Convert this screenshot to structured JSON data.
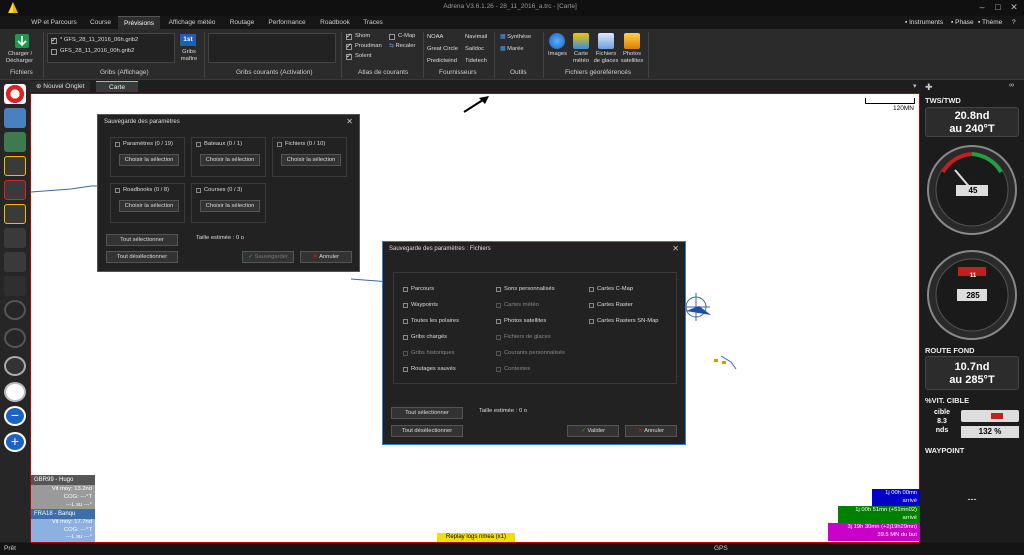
{
  "window": {
    "title": "Adrena V3.6.1.26 - 28_11_2016_a.trc - [Carte]"
  },
  "tabs": [
    "WP et Parcours",
    "Course",
    "Prévisions",
    "Affichage météo",
    "Routage",
    "Performance",
    "Roadbook",
    "Traces"
  ],
  "right_menu": {
    "instruments": "Instruments",
    "phase": "Phase",
    "theme": "Thème"
  },
  "ribbon": {
    "charger": "Charger /",
    "decharger": "Décharger",
    "fichiers": "Fichiers",
    "grib1": "* GFS_28_11_2016_06h.grib2",
    "grib2": "GFS_28_11_2016_00h.grib2",
    "gribs_affichage": "Gribs (Affichage)",
    "first_badge": "1st",
    "gribs_maitre": "Gribs maître",
    "gribs_courants": "Gribs courants (Activation)",
    "shom": "Shom",
    "proudman": "Proudman",
    "solent": "Solent",
    "cmap": "C-Map",
    "recaler": "Recaler",
    "atlas": "Atlas de courants",
    "noaa": "NOAA",
    "navimail": "Navimail",
    "greatcircle": "Great Circle",
    "saildoc": "Saildoc",
    "predictwind": "Predictwind",
    "tidetech": "Tidetech",
    "fournisseurs": "Fournisseurs",
    "synthese": "Synthèse",
    "maree": "Marée",
    "outils": "Outils",
    "images": "Images",
    "carte_meteo": "Carte météo",
    "fichiers_glaces": "Fichiers de glaces",
    "photos_sat": "Photos satellites",
    "fichiers_geo": "Fichiers géoréférencés"
  },
  "doc_tabs": {
    "nouvel_onglet": "Nouvel Onglet",
    "carte": "Carte"
  },
  "map": {
    "scale": "120MN",
    "boat_info_gb": "GBR99 - Hugo",
    "vit_moy_gb": "Vit moy: 13.2nd",
    "cog_gb": "COG: ---°T",
    "lsu_gb": "---L su ---°",
    "boat_info_fr": "FRA18 - Banqu",
    "vit_moy_fr": "Vit moy: 17.7nd",
    "cog_fr": "COG: ---°T",
    "lsu_fr": "---L su ---°",
    "replay": "Replay logs nmea (x1)"
  },
  "routes": [
    {
      "line1": "1j 00h 00mn",
      "line2": "arrivé",
      "color": "#0000c8"
    },
    {
      "line1": "1j 00h 51mn (+51mn02)",
      "line2": "arrivé",
      "color": "#008000"
    },
    {
      "line1": "3j 19h 30mn (+2j19h29mn)",
      "line2": "39.5 MN du but",
      "color": "#c800c8"
    }
  ],
  "panel": {
    "tws_twd": "TWS/TWD",
    "tws": "20.8nd",
    "twd": "au 240°T",
    "dial1_val": "45",
    "dial2_top": "11",
    "dial2_val": "285",
    "route_fond": "ROUTE FOND",
    "rf_speed": "10.7nd",
    "rf_dir": "au 285°T",
    "vit_cible": "%VIT. CIBLE",
    "cible": "cible",
    "cible_val": "8.3",
    "nds": "nds",
    "pct": "132 %",
    "waypoint": "WAYPOINT",
    "wp_val": "---"
  },
  "dlg1": {
    "title": "Sauvegarde des paramètres",
    "groups": [
      {
        "label": "Paramètres (0 / 19)"
      },
      {
        "label": "Bateaux (0 / 1)"
      },
      {
        "label": "Fichiers (0 / 10)"
      },
      {
        "label": "Roadbooks (0 / 8)"
      },
      {
        "label": "Courses (0 / 3)"
      }
    ],
    "choose": "Choisir la sélection",
    "select_all": "Tout sélectionner",
    "deselect_all": "Tout désélectionner",
    "size": "Taille estimée : 0 o",
    "save": "Sauvegarder",
    "cancel": "Annuler"
  },
  "dlg2": {
    "title": "Sauvegarde des paramètres : Fichiers",
    "col1": [
      "Parcours",
      "Waypoints",
      "Toutes les polaires",
      "Gribs chargés",
      "Gribs historiques",
      "Routages sauvés"
    ],
    "col1_dim": [
      false,
      false,
      false,
      false,
      true,
      false
    ],
    "col2": [
      "Sons personnalisés",
      "Cartes météo",
      "Photos satellites",
      "Fichiers de glaces",
      "Courants personnalisés",
      "Contextes"
    ],
    "col2_dim": [
      false,
      true,
      false,
      true,
      true,
      true
    ],
    "col3": [
      "Cartes C-Map",
      "Cartes Raster",
      "Cartes Rasters SN-Map"
    ],
    "select_all": "Tout sélectionner",
    "deselect_all": "Tout désélectionner",
    "size": "Taille estimée : 0 o",
    "ok": "Valider",
    "cancel": "Annuler"
  },
  "status": {
    "left": "Prêt",
    "center": "GPS"
  }
}
